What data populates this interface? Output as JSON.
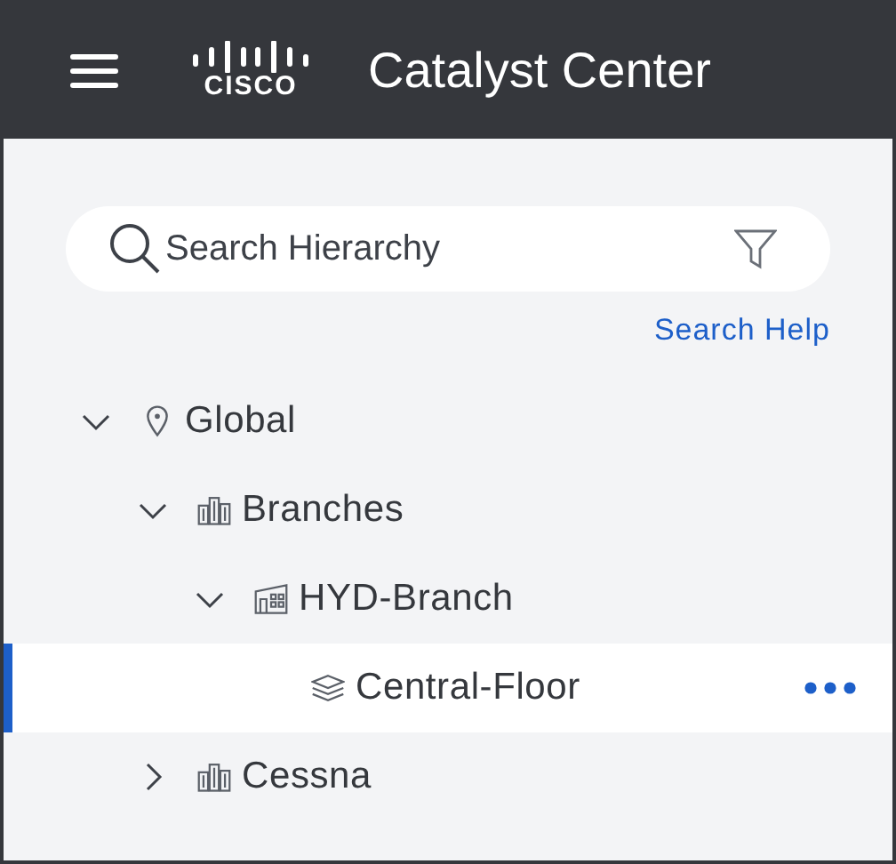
{
  "header": {
    "logo_text": "CISCO",
    "title": "Catalyst Center"
  },
  "search": {
    "placeholder": "Search Hierarchy",
    "help_link": "Search Help"
  },
  "tree": [
    {
      "label": "Global",
      "kind": "site",
      "expandable": true,
      "expanded": true,
      "selected": false,
      "children": [
        {
          "label": "Branches",
          "kind": "area",
          "expandable": true,
          "expanded": true,
          "selected": false,
          "children": [
            {
              "label": "HYD-Branch",
              "kind": "building",
              "expandable": true,
              "expanded": true,
              "selected": false,
              "children": [
                {
                  "label": "Central-Floor",
                  "kind": "floor",
                  "expandable": false,
                  "selected": true
                }
              ]
            }
          ]
        },
        {
          "label": "Cessna",
          "kind": "area",
          "expandable": true,
          "expanded": false,
          "selected": false
        }
      ]
    }
  ]
}
